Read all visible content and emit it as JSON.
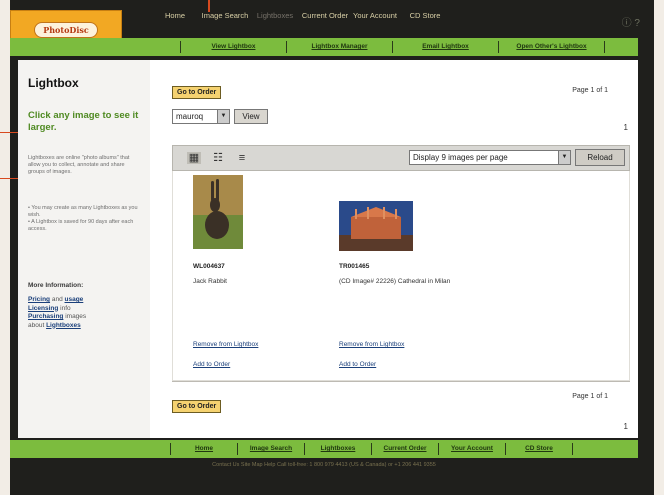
{
  "logo": {
    "text": "PhotoDisc"
  },
  "topnav": [
    {
      "label": "Home"
    },
    {
      "label": "Image Search"
    },
    {
      "label": "Lightboxes"
    },
    {
      "label": "Current Order"
    },
    {
      "label": "Your Account"
    },
    {
      "label": "CD Store"
    }
  ],
  "topnav_icons": "ⓘ ?",
  "subnav": [
    {
      "label": "View Lightbox"
    },
    {
      "label": "Lightbox Manager"
    },
    {
      "label": "Email Lightbox"
    },
    {
      "label": "Open Other's Lightbox"
    }
  ],
  "sidebar": {
    "title": "Lightbox",
    "subtitle": "Click any image to see it larger.",
    "description": "Lightboxes are online \"photo albums\" that allow you to collect, annotate and share groups of images.",
    "bullets": [
      "You may create as many Lightboxes as you wish.",
      "A Lightbox is saved for 90 days after each access."
    ],
    "more_title": "More Information:",
    "links": [
      {
        "pre": "",
        "link": "Pricing",
        "post": " and "
      },
      {
        "pre": "",
        "link": "usage",
        "post": ""
      },
      {
        "pre": "",
        "link": "Licensing",
        "post": " info"
      },
      {
        "pre": "",
        "link": "Purchasing",
        "post": " images"
      },
      {
        "pre": "about ",
        "link": "Lightboxes",
        "post": ""
      }
    ]
  },
  "main": {
    "go_to_order": "Go to Order",
    "page_top": "Page 1 of 1",
    "page_bottom": "Page 1 of 1",
    "lightbox_select": "mauroq",
    "view_btn": "View",
    "per_page": "Display 9 images per page",
    "reload_btn": "Reload",
    "dot": "1"
  },
  "images": [
    {
      "id": "WL004637",
      "caption": "Jack Rabbit",
      "remove": "Remove from Lightbox",
      "add": "Add to Order"
    },
    {
      "id": "TR001465",
      "caption": "(CD Image# 22226) Cathedral in Milan",
      "remove": "Remove from Lightbox",
      "add": "Add to Order"
    }
  ],
  "footer_nav": [
    {
      "label": "Home"
    },
    {
      "label": "Image Search"
    },
    {
      "label": "Lightboxes"
    },
    {
      "label": "Current Order"
    },
    {
      "label": "Your Account"
    },
    {
      "label": "CD Store"
    }
  ],
  "footer_text": "Contact Us   Site Map   Help   Call toll-free: 1 800 979 4413 (US & Canada) or +1 206 441 9355"
}
